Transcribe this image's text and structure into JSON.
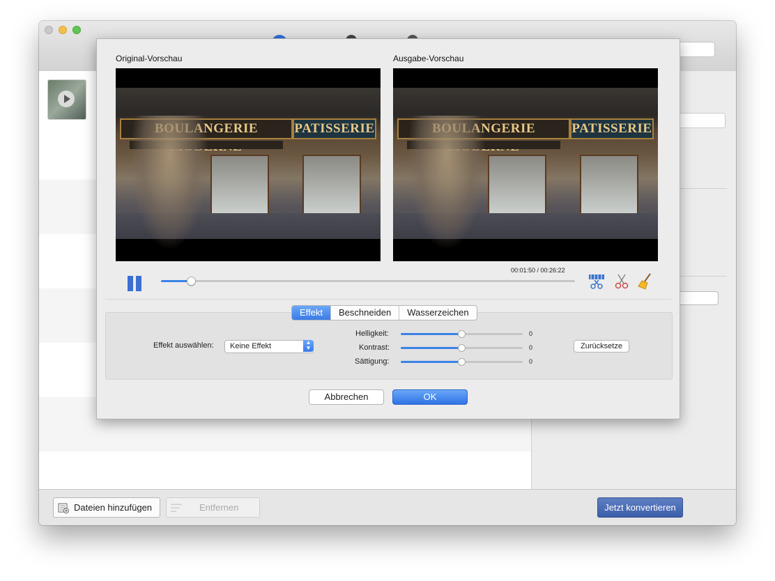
{
  "main_window": {
    "bottombar": {
      "add_files_label": "Dateien hinzufügen",
      "remove_label": "Entfernen",
      "convert_label": "Jetzt konvertieren"
    }
  },
  "dialog": {
    "original_preview_label": "Original-Vorschau",
    "output_preview_label": "Ausgabe-Vorschau",
    "video_scene": {
      "sign_left": "BOULANGERIE MODERNE",
      "sign_right": "PATISSERIE"
    },
    "playback": {
      "time_display": "00:01:50 / 00:26:22",
      "progress": 0.07
    },
    "tabs": [
      {
        "label": "Effekt",
        "active": true
      },
      {
        "label": "Beschneiden",
        "active": false
      },
      {
        "label": "Wasserzeichen",
        "active": false
      }
    ],
    "effect": {
      "select_label": "Effekt auswählen:",
      "select_value": "Keine Effekt",
      "brightness_label": "Helligkeit:",
      "brightness_value": "0",
      "contrast_label": "Kontrast:",
      "contrast_value": "0",
      "saturation_label": "Sättigung:",
      "saturation_value": "0",
      "reset_label": "Zurücksetze"
    },
    "cancel_label": "Abbrechen",
    "ok_label": "OK"
  },
  "colors": {
    "accent_blue": "#3b7be8",
    "convert_button": "#4a6cb8"
  }
}
